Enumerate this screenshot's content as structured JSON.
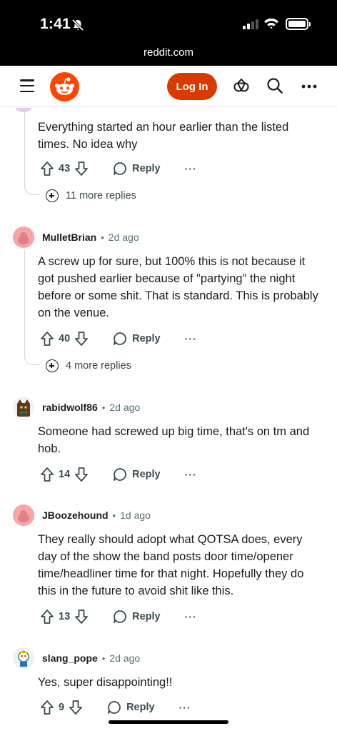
{
  "status_bar": {
    "time": "1:41",
    "url": "reddit.com"
  },
  "header": {
    "login_label": "Log In"
  },
  "colors": {
    "brand": "#ff4500",
    "login_button": "#d93a00",
    "meta_text": "#576f76"
  },
  "comments": [
    {
      "text": "Everything started an hour earlier than the listed times. No idea why",
      "score": "43",
      "reply_label": "Reply",
      "more_label": "···",
      "more_replies": "11 more replies"
    },
    {
      "author": "MulletBrian",
      "time": "2d ago",
      "text": "A screw up for sure, but 100% this is not because it got pushed earlier because of \"partying\" the night before or some shit. That is standard. This is probably on the venue.",
      "score": "40",
      "reply_label": "Reply",
      "more_label": "···",
      "more_replies": "4 more replies"
    },
    {
      "author": "rabidwolf86",
      "time": "2d ago",
      "text": "Someone had screwed up big time, that's on tm and hob.",
      "score": "14",
      "reply_label": "Reply",
      "more_label": "···"
    },
    {
      "author": "JBoozehound",
      "time": "1d ago",
      "text": "They really should adopt what QOTSA does, every day of the show the band posts door time/opener time/headliner time for that night. Hopefully they do this in the future to avoid shit like this.",
      "score": "13",
      "reply_label": "Reply",
      "more_label": "···"
    },
    {
      "author": "slang_pope",
      "time": "2d ago",
      "text": "Yes, super disappointing!!",
      "score": "9",
      "reply_label": "Reply",
      "more_label": "···"
    }
  ],
  "separator": "•"
}
